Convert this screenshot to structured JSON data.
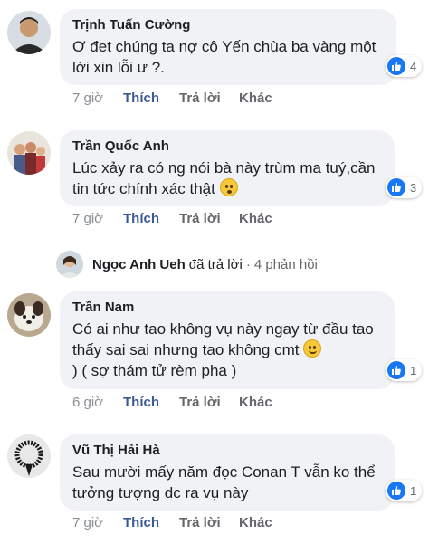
{
  "comments": [
    {
      "author": "Trịnh Tuấn Cường",
      "text": "Ơ đet chúng ta nợ cô Yến chùa ba vàng một lời xin lỗi ư ?.",
      "likes": "4",
      "time": "7 giờ",
      "like_label": "Thích",
      "reply_label": "Trả lời",
      "more_label": "Khác"
    },
    {
      "author": "Trần Quốc Anh",
      "text": "Lúc xảy ra có ng nói bà này trùm ma tuý,cần tin tức chính xác thật",
      "likes": "3",
      "time": "7 giờ",
      "like_label": "Thích",
      "reply_label": "Trả lời",
      "more_label": "Khác"
    },
    {
      "author": "Trần Nam",
      "text": "Có ai như tao không vụ này ngay từ đầu tao thấy sai sai nhưng tao không cmt",
      "text2": ") ( sợ thám tử rèm pha )",
      "likes": "1",
      "time": "6 giờ",
      "like_label": "Thích",
      "reply_label": "Trả lời",
      "more_label": "Khác"
    },
    {
      "author": "Vũ Thị Hải Hà",
      "text": "Sau mười mấy năm đọc Conan T vẫn ko thể tưởng tượng dc ra vụ này",
      "likes": "1",
      "time": "7 giờ",
      "like_label": "Thích",
      "reply_label": "Trả lời",
      "more_label": "Khác"
    }
  ],
  "reply_summary": {
    "name": "Ngọc Anh Ueh",
    "verb": "đã trả lời",
    "dot": "·",
    "count": "4 phản hồi"
  },
  "colors": {
    "bubble": "#f0f2f5",
    "like_blue": "#1877f2",
    "like_label": "#3b5998",
    "muted": "#65676b"
  },
  "icons": [
    "like-icon",
    "smile-emoji-icon",
    "flushed-emoji-icon"
  ]
}
